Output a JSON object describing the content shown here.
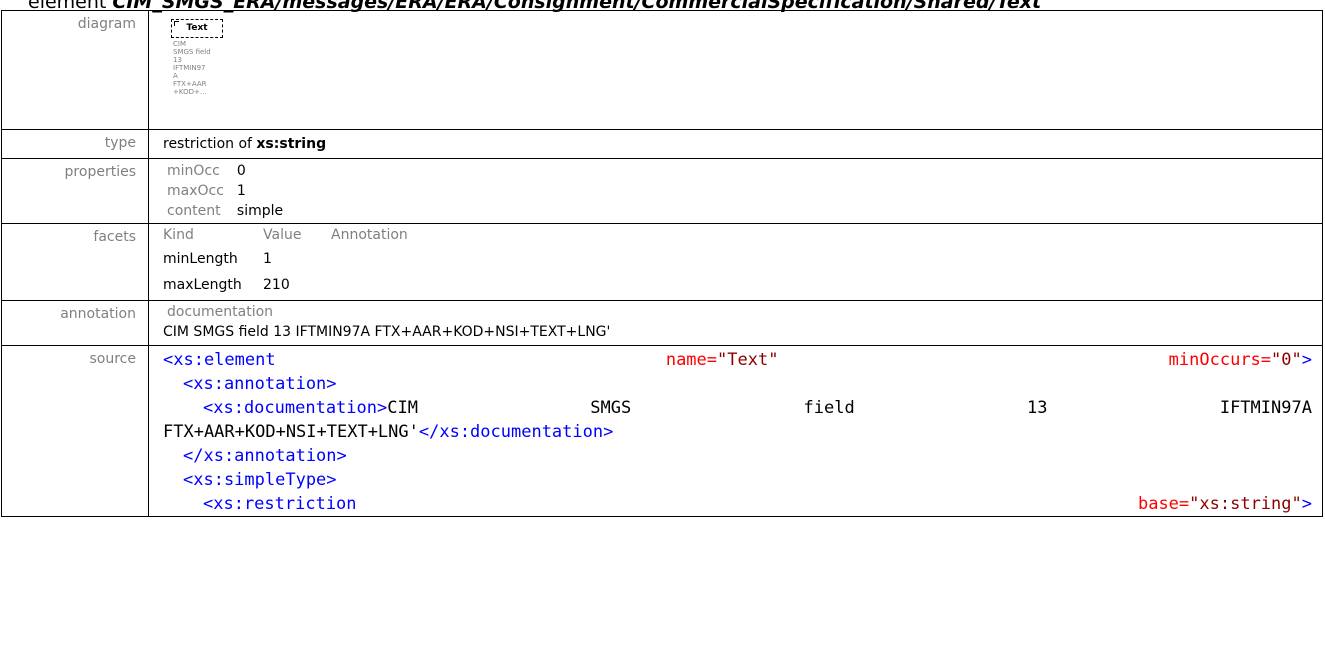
{
  "header": {
    "prefix": "element",
    "path": "CIM_SMGS_ERA/messages/ERA/ERA/Consignment/CommercialSpecification/Shared/Text"
  },
  "labels": {
    "diagram": "diagram",
    "type": "type",
    "properties": "properties",
    "facets": "facets",
    "annotation": "annotation",
    "source": "source"
  },
  "diagram": {
    "box_label": "Text",
    "doc_lines": "CIM\nSMGS field\n13\nIFTMIN97\nA\nFTX+AAR\n+KOD+..."
  },
  "type": {
    "prefix": "restriction of",
    "base": "xs:string"
  },
  "properties": [
    {
      "key": "minOcc",
      "value": "0"
    },
    {
      "key": "maxOcc",
      "value": "1"
    },
    {
      "key": "content",
      "value": "simple"
    }
  ],
  "facets": {
    "headers": [
      "Kind",
      "Value",
      "Annotation"
    ],
    "rows": [
      {
        "kind": "minLength",
        "value": "1",
        "annotation": ""
      },
      {
        "kind": "maxLength",
        "value": "210",
        "annotation": ""
      }
    ]
  },
  "annotation": {
    "heading": "documentation",
    "text": "CIM SMGS field 13 IFTMIN97A FTX+AAR+KOD+NSI+TEXT+LNG'"
  },
  "source": {
    "l1_tag": "<xs:element",
    "l1_attr1": "name=",
    "l1_val1": "\"Text\"",
    "l1_attr2": "minOccurs=",
    "l1_val2": "\"0\"",
    "l1_end": ">",
    "l2": "<xs:annotation>",
    "l3_open": "<xs:documentation>",
    "l3_words": [
      "CIM",
      "SMGS",
      "field",
      "13",
      "IFTMIN97A"
    ],
    "l4_text": "FTX+AAR+KOD+NSI+TEXT+LNG'",
    "l4_close": "</xs:documentation>",
    "l5": "</xs:annotation>",
    "l6": "<xs:simpleType>",
    "l7_tag": "<xs:restriction",
    "l7_attr": "base=",
    "l7_val": "\"xs:string\"",
    "l7_end": ">"
  },
  "colors": {
    "tag": "#0000ff",
    "attr": "#ff0000",
    "attr_value": "#8b0000",
    "label": "#808080"
  }
}
